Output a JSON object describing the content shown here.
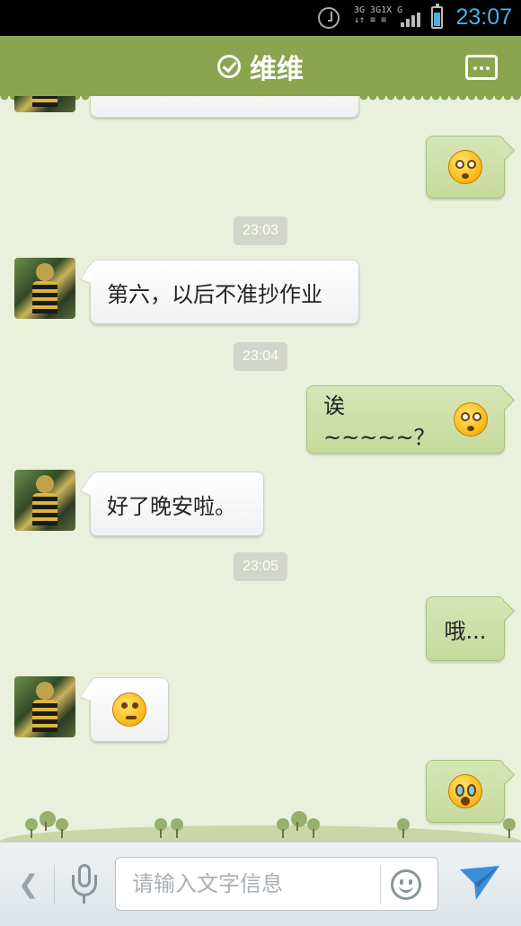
{
  "status_bar": {
    "clock": "23:07",
    "network_top": "3G 3G1X G",
    "network_bottom": "↓↑ ≡ ≡",
    "battery_level": 0.7
  },
  "header": {
    "title": "维维",
    "online_icon": "check-circle-icon",
    "menu_icon": "more-options-icon"
  },
  "messages": [
    {
      "type": "in",
      "text": ""
    },
    {
      "type": "out",
      "emoji": "dizzy-face-emoji"
    },
    {
      "type": "time",
      "text": "23:03"
    },
    {
      "type": "in",
      "text": "第六，以后不准抄作业"
    },
    {
      "type": "time",
      "text": "23:04"
    },
    {
      "type": "out",
      "text": "诶~~~~~？",
      "emoji": "dizzy-face-emoji"
    },
    {
      "type": "in",
      "text": "好了晚安啦。"
    },
    {
      "type": "time",
      "text": "23:05"
    },
    {
      "type": "out",
      "text": "哦..."
    },
    {
      "type": "in",
      "emoji": "thinking-face-emoji"
    },
    {
      "type": "out",
      "emoji": "crying-face-emoji"
    }
  ],
  "input_bar": {
    "placeholder": "请输入文字信息",
    "back_icon": "chevron-left-icon",
    "voice_icon": "microphone-icon",
    "emoji_icon": "smiley-icon",
    "send_icon": "send-arrow-icon"
  },
  "colors": {
    "header": "#8aa54f",
    "background": "#e9f0dc",
    "outgoing_bubble": "#c9dca3",
    "incoming_bubble": "#ffffff",
    "clock": "#49b1e6"
  }
}
